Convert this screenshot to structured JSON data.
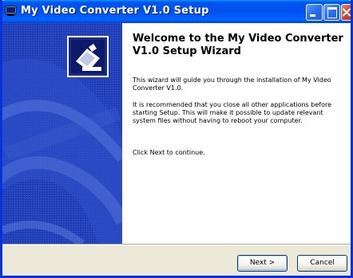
{
  "window": {
    "title": "My Video Converter V1.0 Setup"
  },
  "colors": {
    "titlebar": "#0050ee",
    "side_panel": "#1a3bb0",
    "close_button": "#d2462b",
    "dialog_face": "#ece9d8"
  },
  "wizard": {
    "heading": "Welcome to the My Video Converter V1.0 Setup Wizard",
    "paragraphs": [
      "This wizard will guide you through the installation of My Video Converter V1.0.",
      "It is recommended that you close all other applications before starting Setup. This will make it possible to update relevant system files without having to reboot your computer.",
      "Click Next to continue."
    ]
  },
  "buttons": {
    "next": "Next >",
    "cancel": "Cancel"
  },
  "icons": {
    "title": "installer-window-icon",
    "panel": "installer-box-icon"
  }
}
